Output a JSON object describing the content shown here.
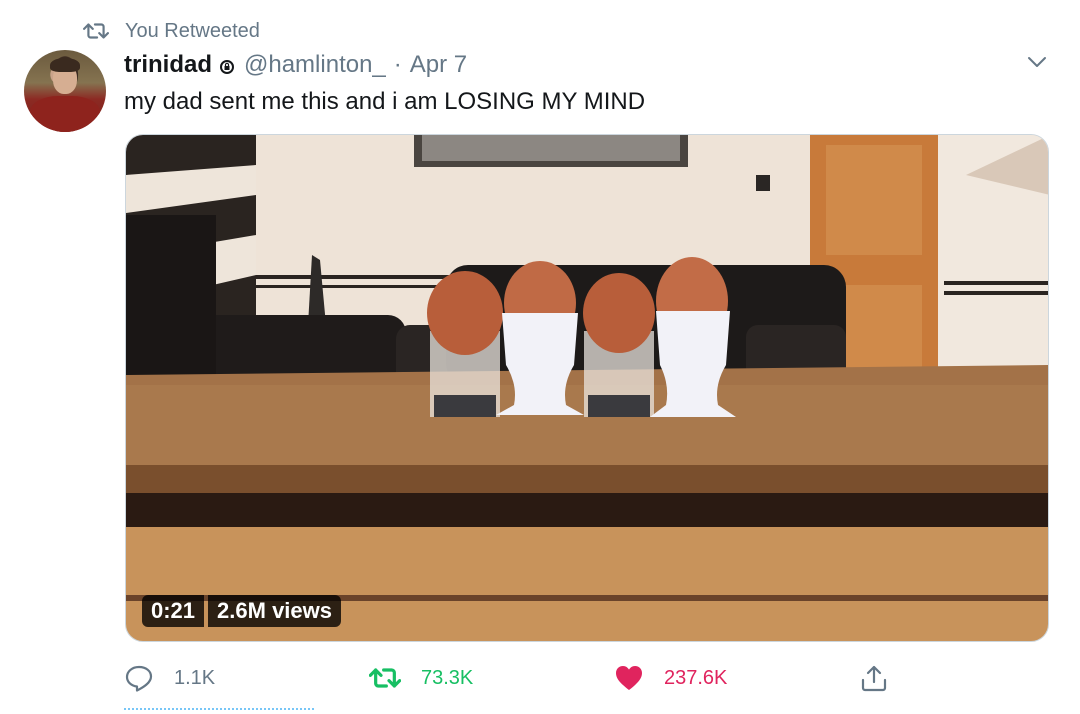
{
  "retweet_banner": {
    "label": "You Retweeted",
    "icon": "retweet-icon"
  },
  "author": {
    "name": "trinidad",
    "handle": "@hamlinton_",
    "separator": "·",
    "date": "Apr 7"
  },
  "tweet": {
    "text": "my dad sent me this and i am LOSING MY MIND"
  },
  "media": {
    "duration": "0:21",
    "views": "2.6M views"
  },
  "actions": {
    "reply_count": "1.1K",
    "retweet_count": "73.3K",
    "like_count": "237.6K"
  },
  "colors": {
    "muted": "#657786",
    "retweet_active": "#17bf63",
    "like_active": "#e0245e"
  }
}
